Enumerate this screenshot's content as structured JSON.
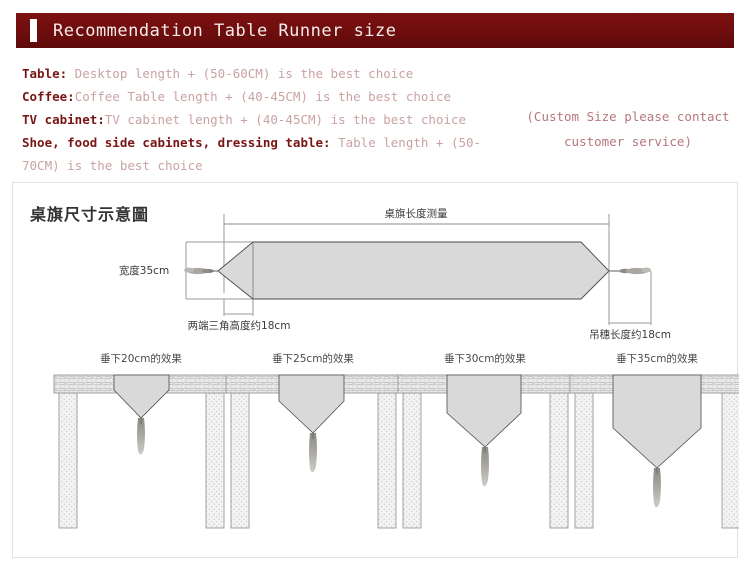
{
  "header": {
    "title": "Recommendation Table Runner size",
    "bg_color": "#7c1010",
    "accent_bar_color": "#ffffff",
    "title_color": "#f4ecec"
  },
  "recommendations": {
    "lines": [
      {
        "label": "Table:",
        "text": " Desktop length + (50-60CM) is the best choice"
      },
      {
        "label": "Coffee:",
        "text": "Coffee Table length + (40-45CM) is the best choice"
      },
      {
        "label": "TV cabinet:",
        "text": "TV cabinet length + (40-45CM) is the best choice"
      },
      {
        "label": "Shoe, food side cabinets, dressing table:",
        "text": " Table length + (50-70CM) is the best choice"
      }
    ],
    "label_color": "#7a1414",
    "body_color": "#c9a2a2"
  },
  "custom_note": {
    "line1": "(Custom Size please contact",
    "line2": "customer service)",
    "color": "#b4787c"
  },
  "diagram": {
    "title": "桌旗尺寸示意圖",
    "length_measure_label": "桌旗长度测量",
    "width_label": "宽度35cm",
    "triangle_height_label": "两端三角高度约18cm",
    "tassel_length_label": "吊穗长度约18cm",
    "runner_fill": "#d9d9d9",
    "runner_stroke": "#4a4a4a",
    "dim_line_color": "#8a8a8a"
  },
  "table_examples": [
    {
      "label": "垂下20cm的效果",
      "drop": 20
    },
    {
      "label": "垂下25cm的效果",
      "drop": 25
    },
    {
      "label": "垂下30cm的效果",
      "drop": 30
    },
    {
      "label": "垂下35cm的效果",
      "drop": 35
    }
  ]
}
